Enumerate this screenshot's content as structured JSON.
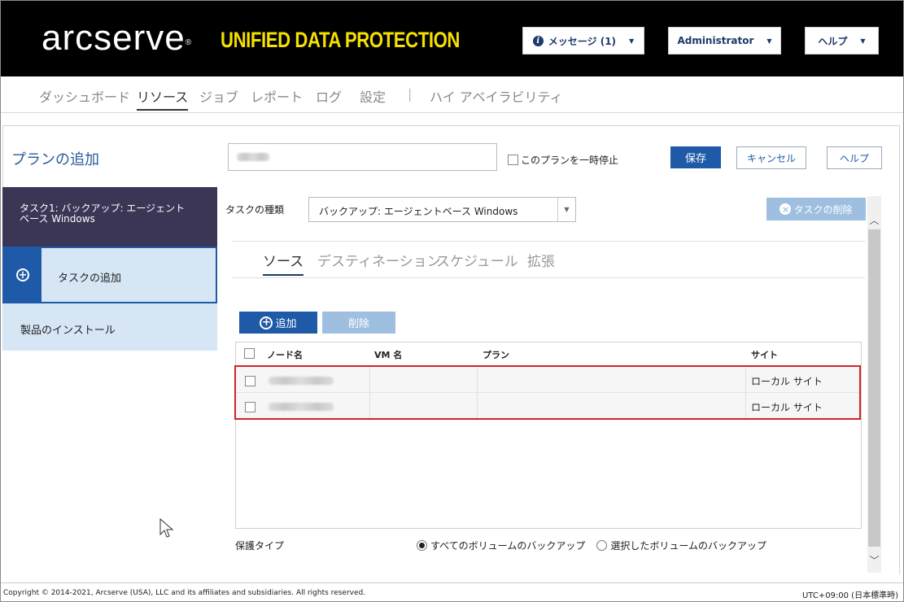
{
  "header": {
    "logo": "arcserve",
    "logo_mark": "®",
    "product": "UNIFIED DATA PROTECTION",
    "messages_label": "メッセージ (1)",
    "user_label": "Administrator",
    "help_label": "ヘルプ"
  },
  "nav": {
    "items": [
      {
        "label": "ダッシュボード"
      },
      {
        "label": "リソース"
      },
      {
        "label": "ジョブ"
      },
      {
        "label": "レポート"
      },
      {
        "label": "ログ"
      },
      {
        "label": "設定"
      },
      {
        "label": "ハイ アベイラビリティ"
      }
    ],
    "separator": "|"
  },
  "plan": {
    "title": "プランの追加",
    "suspend_label": "このプランを一時停止",
    "save_label": "保存",
    "cancel_label": "キャンセル",
    "help_label": "ヘルプ"
  },
  "sidebar": {
    "task1_line1": "タスク1: バックアップ: エージェント",
    "task1_line2": "ベース Windows",
    "add_task_label": "タスクの追加",
    "install_label": "製品のインストール"
  },
  "task": {
    "type_label": "タスクの種類",
    "type_value": "バックアップ: エージェントベース Windows",
    "delete_label": "タスクの削除"
  },
  "tabs": [
    {
      "label": "ソース"
    },
    {
      "label": "デスティネーション"
    },
    {
      "label": "スケジュール"
    },
    {
      "label": "拡張"
    }
  ],
  "source": {
    "add_label": "追加",
    "remove_label": "削除",
    "columns": [
      "ノード名",
      "VM 名",
      "プラン",
      "サイト"
    ],
    "rows": [
      {
        "site": "ローカル サイト"
      },
      {
        "site": "ローカル サイト"
      }
    ]
  },
  "protection": {
    "label": "保護タイプ",
    "option_all": "すべてのボリュームのバックアップ",
    "option_selected": "選択したボリュームのバックアップ"
  },
  "footer": {
    "copyright": "Copyright © 2014-2021, Arcserve (USA), LLC and its affiliates and subsidiaries. All rights reserved.",
    "timezone": "UTC+09:00 (日本標準時)"
  },
  "colors": {
    "accent": "#1f5aa8",
    "highlight": "#d2232a",
    "brand_yellow": "#f5e000"
  }
}
